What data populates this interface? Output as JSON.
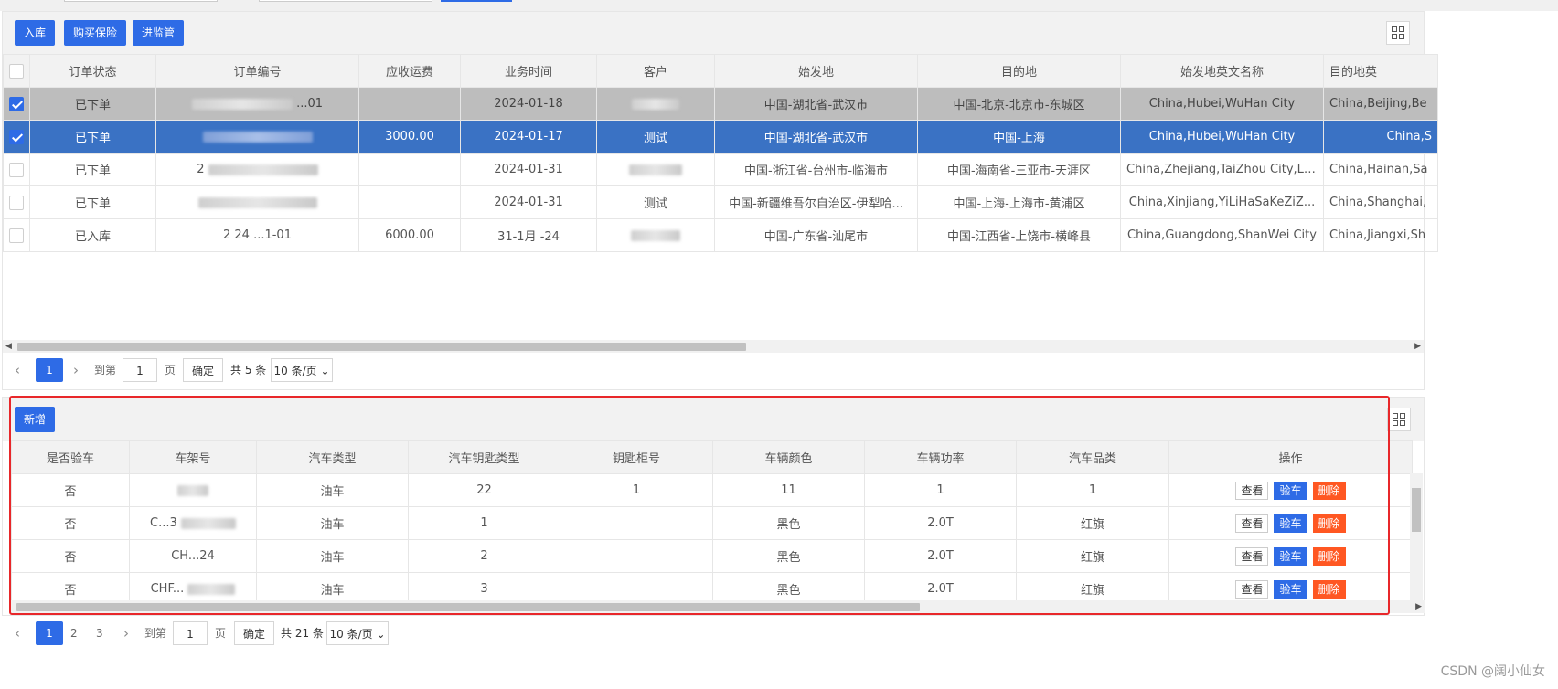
{
  "toolbar_top": {
    "buttons": [
      "入库",
      "购买保险",
      "进监管"
    ],
    "columns_icon": "grid-columns-icon"
  },
  "orders_table": {
    "headers": [
      "订单状态",
      "订单编号",
      "应收运费",
      "业务时间",
      "客户",
      "始发地",
      "目的地",
      "始发地英文名称",
      "目的地英"
    ],
    "rows": [
      {
        "checked": true,
        "status": "已下单",
        "order_no": "...01",
        "freight": "",
        "date": "2024-01-18",
        "customer": "",
        "origin": "中国-湖北省-武汉市",
        "destination": "中国-北京-北京市-东城区",
        "origin_en": "China,Hubei,WuHan City",
        "dest_en": "China,Beijing,Be"
      },
      {
        "checked": true,
        "status": "已下单",
        "order_no": "",
        "freight": "3000.00",
        "date": "2024-01-17",
        "customer": "测试",
        "origin": "中国-湖北省-武汉市",
        "destination": "中国-上海",
        "origin_en": "China,Hubei,WuHan City",
        "dest_en": "China,S"
      },
      {
        "checked": false,
        "status": "已下单",
        "order_no": "2",
        "freight": "",
        "date": "2024-01-31",
        "customer": "",
        "origin": "中国-浙江省-台州市-临海市",
        "destination": "中国-海南省-三亚市-天涯区",
        "origin_en": "China,Zhejiang,TaiZhou City,Li...",
        "dest_en": "China,Hainan,Sa"
      },
      {
        "checked": false,
        "status": "已下单",
        "order_no": "",
        "freight": "",
        "date": "2024-01-31",
        "customer": "测试",
        "origin": "中国-新疆维吾尔自治区-伊犁哈...",
        "destination": "中国-上海-上海市-黄浦区",
        "origin_en": "China,Xinjiang,YiLiHaSaKeZiZ...",
        "dest_en": "China,Shanghai,"
      },
      {
        "checked": false,
        "status": "已入库",
        "order_no": "2 24 ...1-01",
        "freight": "6000.00",
        "date": "31-1月 -24",
        "customer": "",
        "origin": "中国-广东省-汕尾市",
        "destination": "中国-江西省-上饶市-横峰县",
        "origin_en": "China,Guangdong,ShanWei City",
        "dest_en": "China,Jiangxi,Sh"
      }
    ]
  },
  "pager_top": {
    "current": "1",
    "goto_label": "到第",
    "goto_value": "1",
    "page_label": "页",
    "confirm": "确定",
    "total": "共 5 条",
    "page_size": "10 条/页"
  },
  "toolbar_bottom": {
    "add_button": "新增"
  },
  "cars_table": {
    "headers": [
      "是否验车",
      "车架号",
      "汽车类型",
      "汽车钥匙类型",
      "钥匙柜号",
      "车辆颜色",
      "车辆功率",
      "汽车品类",
      "操作"
    ],
    "rows": [
      {
        "inspected": "否",
        "vin": "",
        "type": "油车",
        "key_type": "22",
        "cabinet": "1",
        "color": "11",
        "power": "1",
        "brand": "1"
      },
      {
        "inspected": "否",
        "vin": "C...3",
        "type": "油车",
        "key_type": "1",
        "cabinet": "",
        "color": "黑色",
        "power": "2.0T",
        "brand": "红旗"
      },
      {
        "inspected": "否",
        "vin": "CH...24",
        "type": "油车",
        "key_type": "2",
        "cabinet": "",
        "color": "黑色",
        "power": "2.0T",
        "brand": "红旗"
      },
      {
        "inspected": "否",
        "vin": "CHF...",
        "type": "油车",
        "key_type": "3",
        "cabinet": "",
        "color": "黑色",
        "power": "2.0T",
        "brand": "红旗"
      }
    ],
    "actions": {
      "view": "查看",
      "inspect": "验车",
      "delete": "删除"
    }
  },
  "pager_bottom": {
    "pages": [
      "1",
      "2",
      "3"
    ],
    "goto_label": "到第",
    "goto_value": "1",
    "page_label": "页",
    "confirm": "确定",
    "total": "共 21 条",
    "page_size": "10 条/页"
  },
  "watermark": "CSDN @阔小仙女",
  "colors": {
    "primary": "#2e6be6",
    "danger": "#ff5722",
    "selected_row": "#3a72c4",
    "highlight_box": "#e8272a"
  }
}
